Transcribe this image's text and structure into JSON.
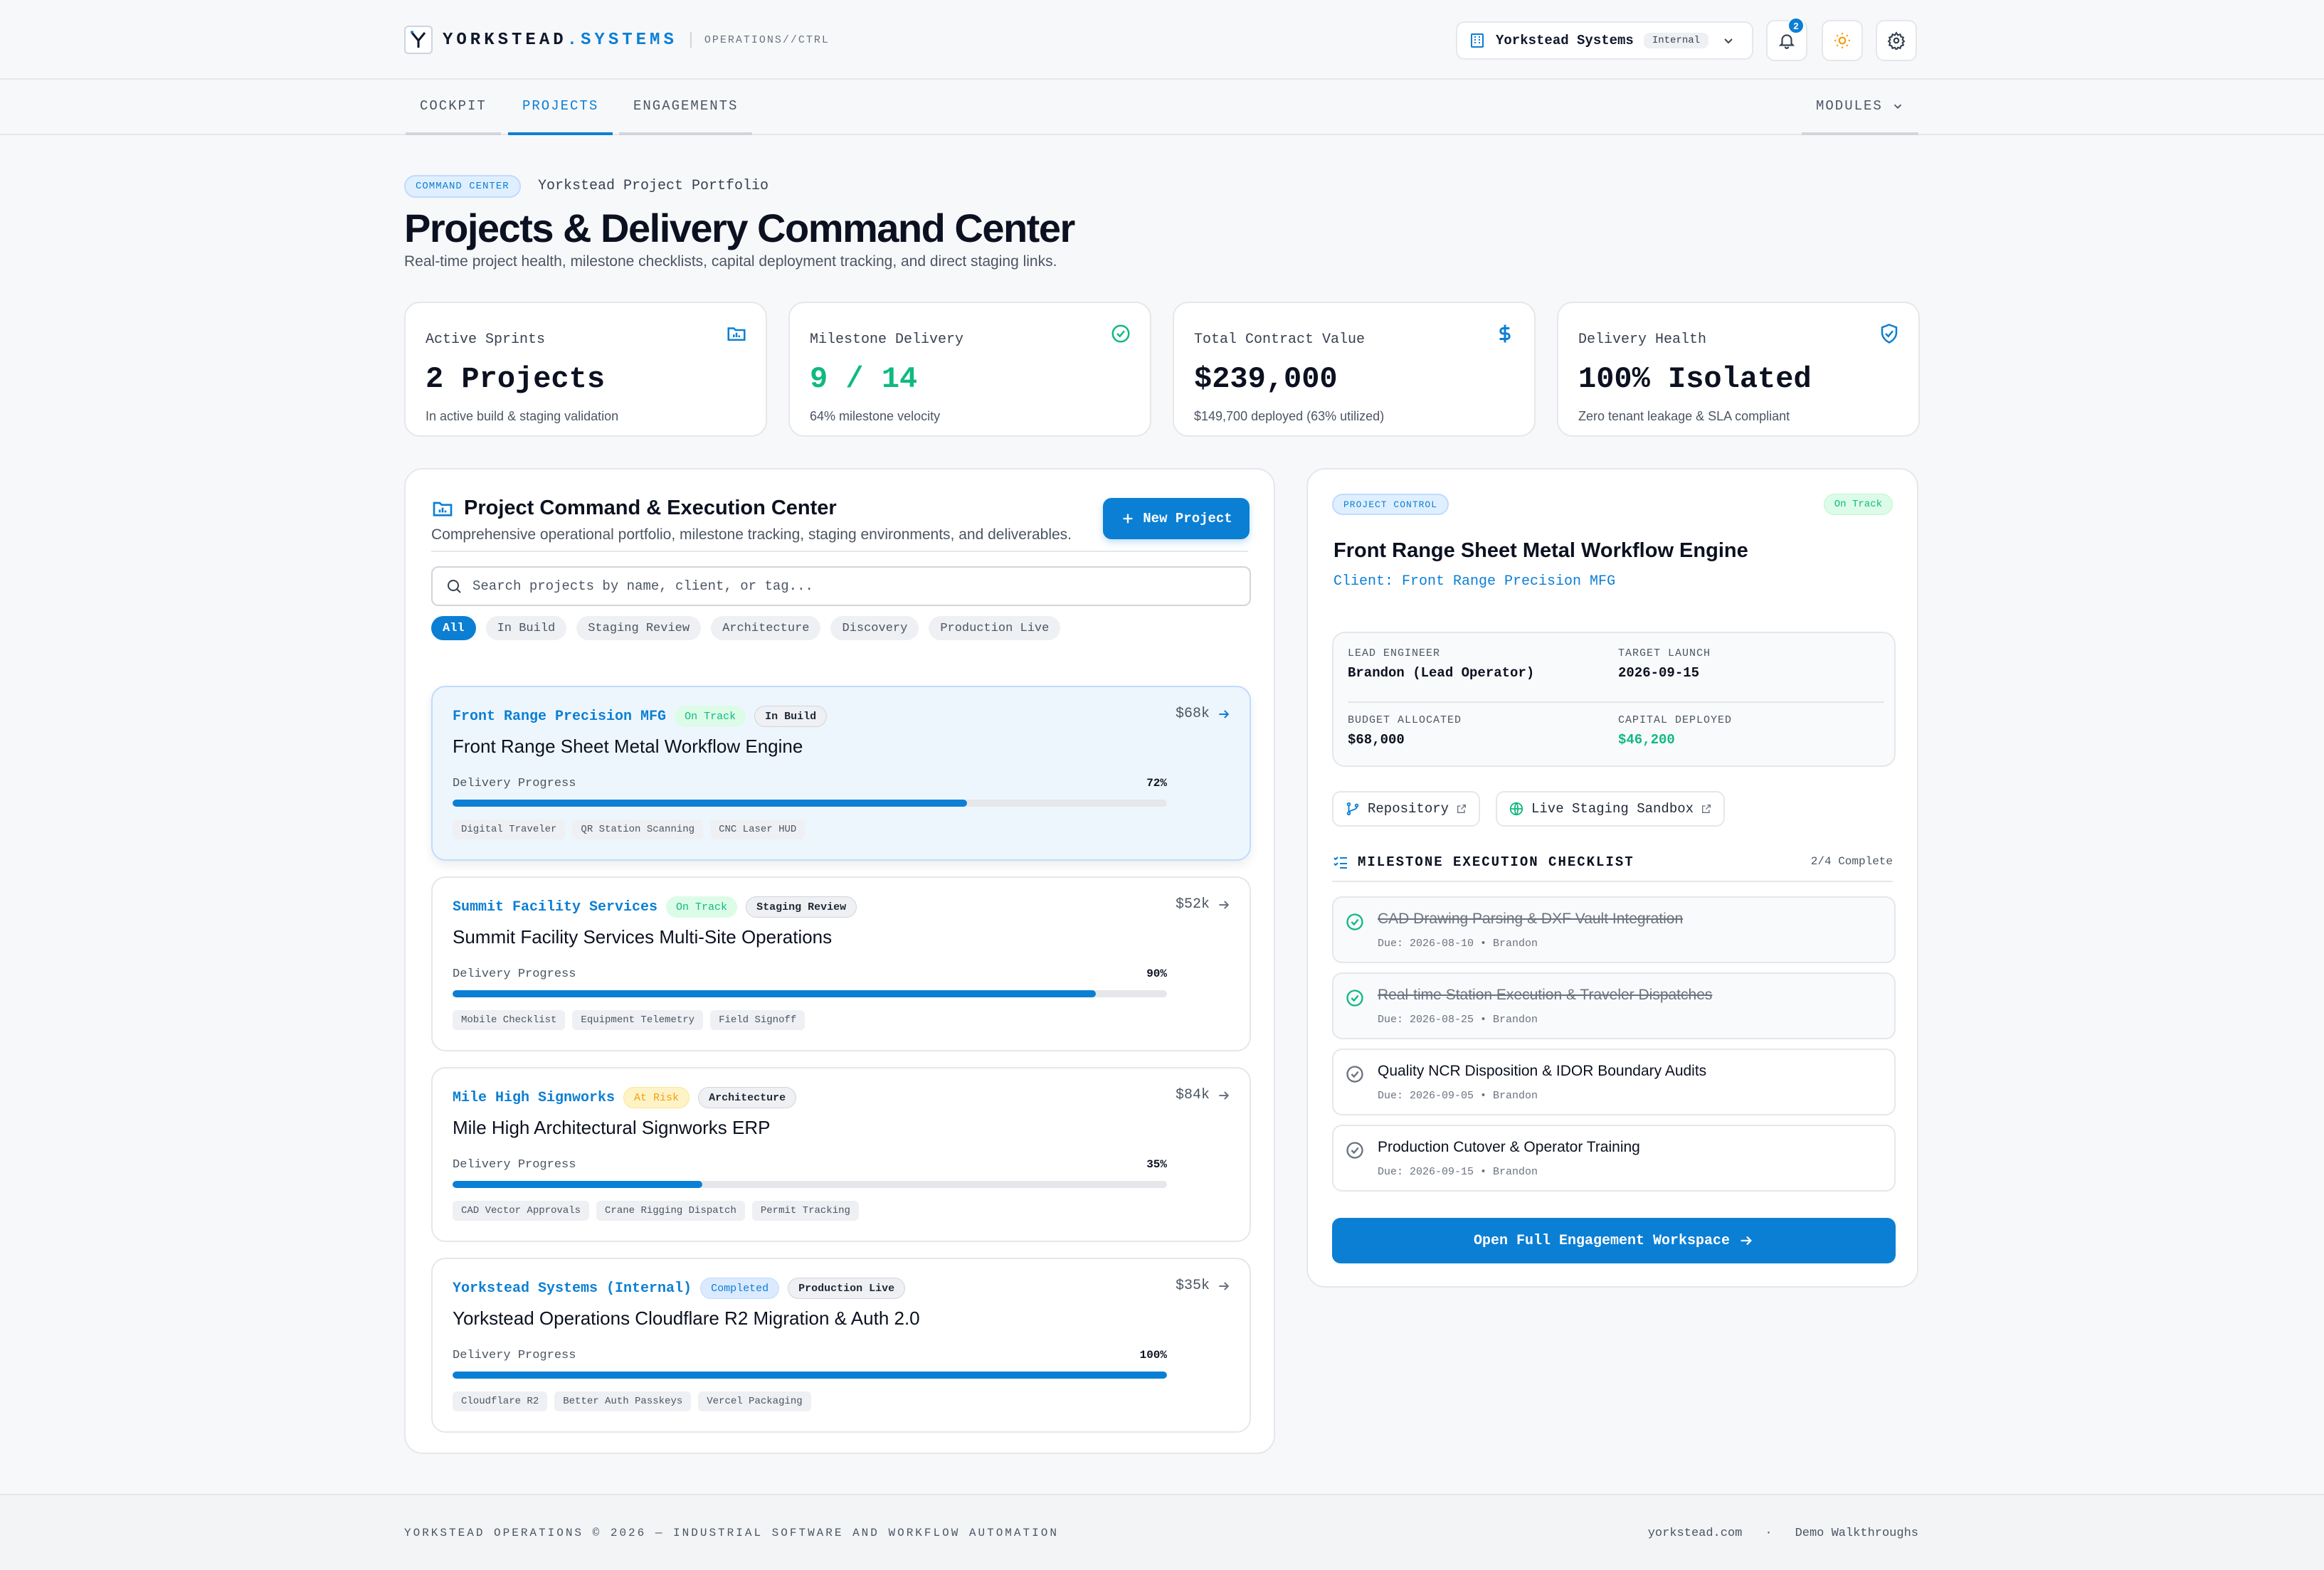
{
  "header": {
    "brand_part1": "YORKSTEAD",
    "brand_part2": ".SYSTEMS",
    "brand_sub": "OPERATIONS//CTRL",
    "org_name": "Yorkstead Systems",
    "org_badge": "Internal",
    "notification_count": "2",
    "icons": [
      "building-icon",
      "chevron-down-icon",
      "bell-icon",
      "sun-icon",
      "gear-icon"
    ]
  },
  "nav": {
    "tabs": [
      {
        "label": "COCKPIT",
        "active": false
      },
      {
        "label": "PROJECTS",
        "active": true
      },
      {
        "label": "ENGAGEMENTS",
        "active": false
      }
    ],
    "modules_label": "MODULES"
  },
  "page": {
    "badge": "COMMAND CENTER",
    "subtitle": "Yorkstead Project Portfolio",
    "title": "Projects & Delivery Command Center",
    "description": "Real-time project health, milestone checklists, capital deployment tracking, and direct staging links."
  },
  "kpis": [
    {
      "label": "Active Sprints",
      "value": "2 Projects",
      "note": "In active build & staging validation",
      "icon": "folder-chart-icon"
    },
    {
      "label": "Milestone Delivery",
      "value": "9 / 14",
      "note": "64% milestone velocity",
      "icon": "check-circle-icon"
    },
    {
      "label": "Total Contract Value",
      "value": "$239,000",
      "note": "$149,700 deployed (63% utilized)",
      "icon": "dollar-icon"
    },
    {
      "label": "Delivery Health",
      "value": "100% Isolated",
      "note": "Zero tenant leakage & SLA compliant",
      "icon": "shield-check-icon"
    }
  ],
  "projects_panel": {
    "title": "Project Command & Execution Center",
    "subtitle": "Comprehensive operational portfolio, milestone tracking, staging environments, and deliverables.",
    "new_button": "New Project",
    "search_placeholder": "Search projects by name, client, or tag...",
    "filters": [
      "All",
      "In Build",
      "Staging Review",
      "Architecture",
      "Discovery",
      "Production Live"
    ],
    "active_filter": "All",
    "progress_label": "Delivery Progress",
    "projects": [
      {
        "client": "Front Range Precision MFG",
        "status": "On Track",
        "stage": "In Build",
        "amount": "$68k",
        "name": "Front Range Sheet Metal Workflow Engine",
        "progress": 72,
        "progress_text": "72%",
        "tags": [
          "Digital Traveler",
          "QR Station Scanning",
          "CNC Laser HUD"
        ],
        "selected": true
      },
      {
        "client": "Summit Facility Services",
        "status": "On Track",
        "stage": "Staging Review",
        "amount": "$52k",
        "name": "Summit Facility Services Multi-Site Operations",
        "progress": 90,
        "progress_text": "90%",
        "tags": [
          "Mobile Checklist",
          "Equipment Telemetry",
          "Field Signoff"
        ],
        "selected": false
      },
      {
        "client": "Mile High Signworks",
        "status": "At Risk",
        "stage": "Architecture",
        "amount": "$84k",
        "name": "Mile High Architectural Signworks ERP",
        "progress": 35,
        "progress_text": "35%",
        "tags": [
          "CAD Vector Approvals",
          "Crane Rigging Dispatch",
          "Permit Tracking"
        ],
        "selected": false
      },
      {
        "client": "Yorkstead Systems (Internal)",
        "status": "Completed",
        "stage": "Production Live",
        "amount": "$35k",
        "name": "Yorkstead Operations Cloudflare R2 Migration & Auth 2.0",
        "progress": 100,
        "progress_text": "100%",
        "tags": [
          "Cloudflare R2",
          "Better Auth Passkeys",
          "Vercel Packaging"
        ],
        "selected": false
      }
    ]
  },
  "detail": {
    "badge": "PROJECT CONTROL",
    "status": "On Track",
    "title": "Front Range Sheet Metal Workflow Engine",
    "client": "Client: Front Range Precision MFG",
    "lead_engineer_label": "LEAD ENGINEER",
    "lead_engineer": "Brandon (Lead Operator)",
    "target_launch_label": "TARGET LAUNCH",
    "target_launch": "2026-09-15",
    "budget_label": "BUDGET ALLOCATED",
    "budget": "$68,000",
    "deployed_label": "CAPITAL DEPLOYED",
    "deployed": "$46,200",
    "repo_button": "Repository",
    "staging_button": "Live Staging Sandbox",
    "checklist_title": "MILESTONE EXECUTION CHECKLIST",
    "checklist_count": "2/4 Complete",
    "milestones": [
      {
        "title": "CAD Drawing Parsing & DXF Vault Integration",
        "meta": "Due: 2026-08-10 • Brandon",
        "done": true
      },
      {
        "title": "Real-time Station Execution & Traveler Dispatches",
        "meta": "Due: 2026-08-25 • Brandon",
        "done": true
      },
      {
        "title": "Quality NCR Disposition & IDOR Boundary Audits",
        "meta": "Due: 2026-09-05 • Brandon",
        "done": false
      },
      {
        "title": "Production Cutover & Operator Training",
        "meta": "Due: 2026-09-15 • Brandon",
        "done": false
      }
    ],
    "open_button": "Open Full Engagement Workspace"
  },
  "footer": {
    "left": "YORKSTEAD OPERATIONS © 2026 — INDUSTRIAL SOFTWARE AND WORKFLOW AUTOMATION",
    "link1": "yorkstead.com",
    "sep": "·",
    "link2": "Demo Walkthroughs"
  },
  "colors": {
    "accent": "#0b7fd4",
    "success": "#10b981",
    "warning": "#f59e0b"
  }
}
